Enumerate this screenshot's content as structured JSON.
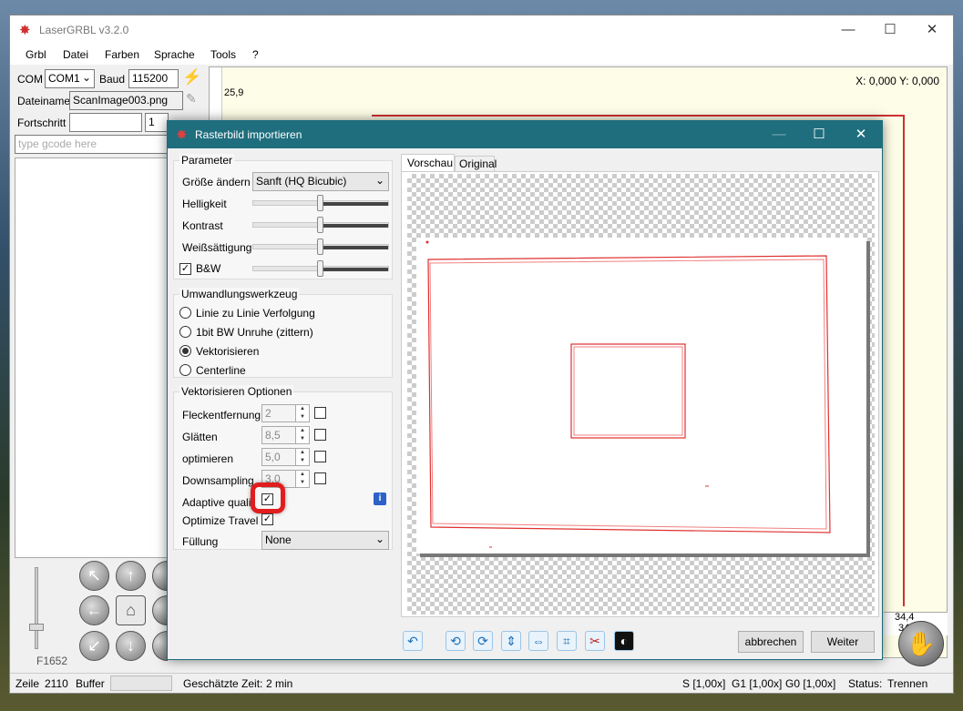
{
  "app": {
    "title": "LaserGRBL v3.2.0"
  },
  "menu": [
    "Grbl",
    "Datei",
    "Farben",
    "Sprache",
    "Tools",
    "?"
  ],
  "connection": {
    "com_label": "COM",
    "com_value": "COM1",
    "baud_label": "Baud",
    "baud_value": "115200"
  },
  "file": {
    "label": "Dateiname",
    "value": "ScanImage003.png"
  },
  "progress": {
    "label": "Fortschritt",
    "value": "1"
  },
  "gcode": {
    "placeholder": "type gcode here"
  },
  "canvas": {
    "coords": "X: 0,000 Y: 0,000",
    "ruler_top_value": "25,9",
    "ruler_x_value": "34,4",
    "ruler_x_value2": "34,0"
  },
  "feed": {
    "label": "F1652"
  },
  "status": {
    "zeile_label": "Zeile",
    "zeile_value": "2110",
    "buffer_label": "Buffer",
    "time_label": "Geschätzte Zeit:",
    "time_value": "2 min",
    "s": "S [1,00x]",
    "g1": "G1 [1,00x]",
    "g0": "G0 [1,00x]",
    "status_label": "Status:",
    "status_value": "Trennen"
  },
  "dialog": {
    "title": "Rasterbild importieren",
    "parameter": {
      "title": "Parameter",
      "resize_label": "Größe ändern",
      "resize_value": "Sanft (HQ Bicubic)",
      "brightness": "Helligkeit",
      "brightness_level": 0.5,
      "contrast": "Kontrast",
      "contrast_level": 0.5,
      "white": "Weißsättigung",
      "white_level": 0.5,
      "bw": "B&W",
      "bw_level": 0.5
    },
    "tool": {
      "title": "Umwandlungswerkzeug",
      "options": [
        "Linie zu Linie Verfolgung",
        "1bit BW Unruhe (zittern)",
        "Vektorisieren",
        "Centerline"
      ],
      "selected": 2
    },
    "vector": {
      "title": "Vektorisieren Optionen",
      "flecken_label": "Fleckentfernung",
      "flecken_value": "2",
      "glaetten_label": "Glätten",
      "glaetten_value": "8,5",
      "optimieren_label": "optimieren",
      "optimieren_value": "5,0",
      "downsampling_label": "Downsampling",
      "downsampling_value": "3,0",
      "adaptive_label": "Adaptive quality",
      "optimize_travel_label": "Optimize Travel",
      "fill_label": "Füllung",
      "fill_value": "None"
    },
    "tabs": [
      "Vorschau",
      "Original"
    ],
    "buttons": {
      "cancel": "abbrechen",
      "next": "Weiter"
    }
  }
}
